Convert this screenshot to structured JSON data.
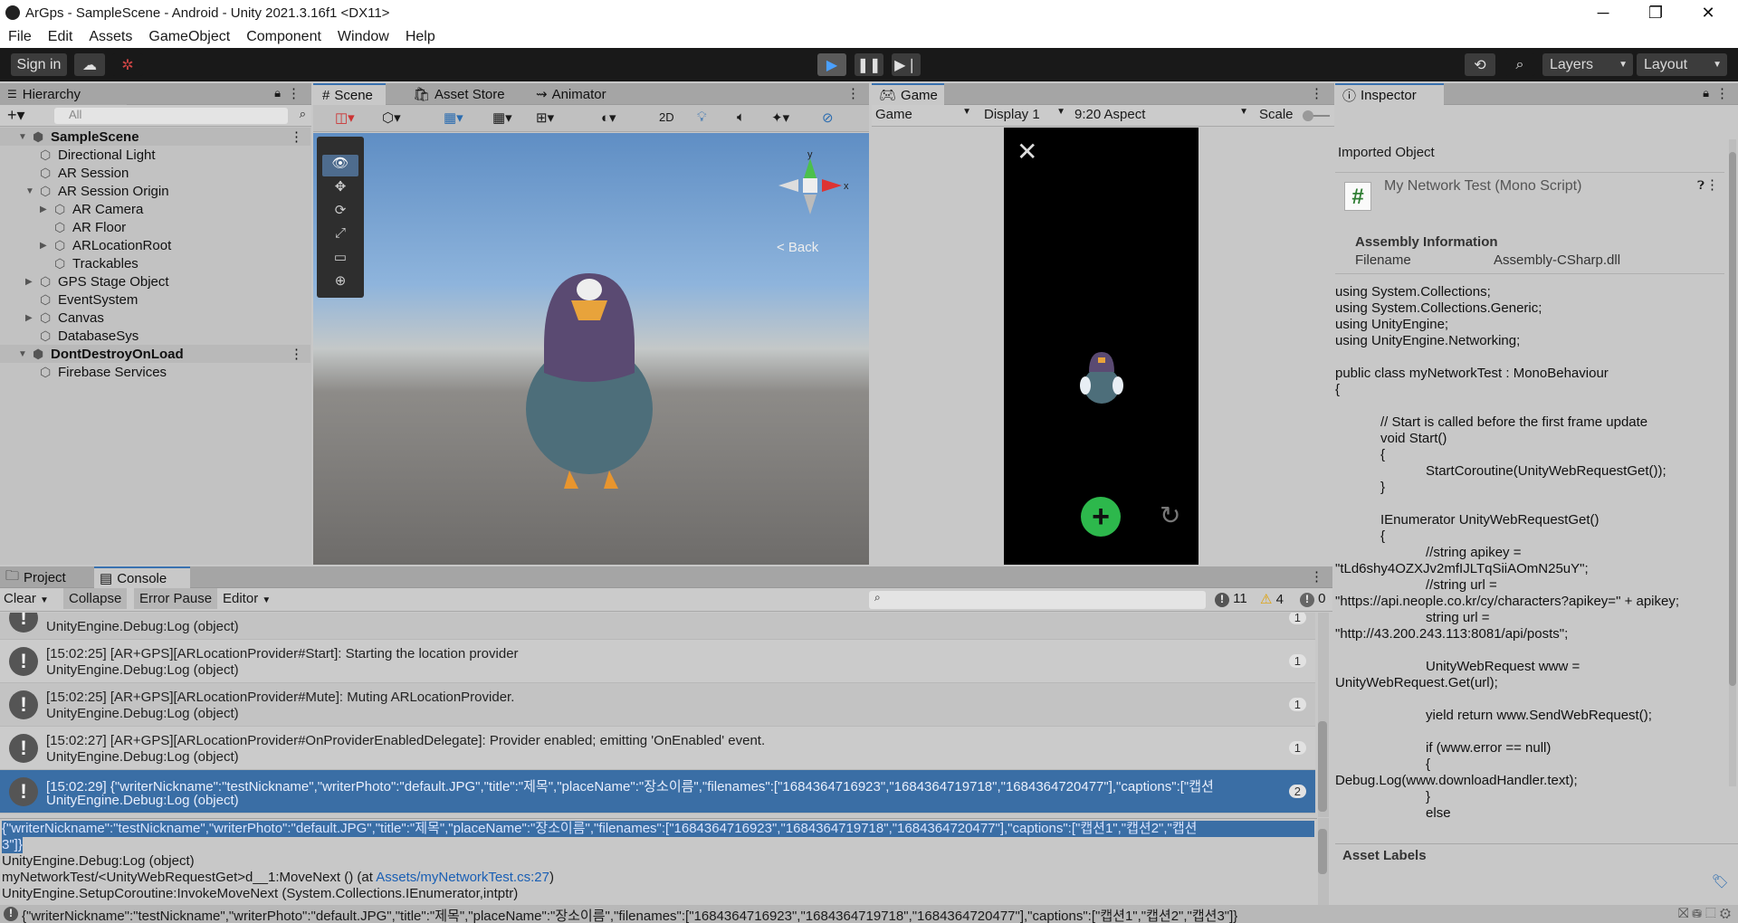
{
  "window": {
    "title": "ArGps - SampleScene - Android - Unity 2021.3.16f1 <DX11>"
  },
  "menu": [
    "File",
    "Edit",
    "Assets",
    "GameObject",
    "Component",
    "Window",
    "Help"
  ],
  "toolbar": {
    "sign_in": "Sign in",
    "layers": "Layers",
    "layout": "Layout"
  },
  "hierarchy": {
    "tab": "Hierarchy",
    "search_placeholder": "All",
    "items": [
      {
        "label": "SampleScene",
        "indent": 0,
        "scene": true,
        "expanded": true
      },
      {
        "label": "Directional Light",
        "indent": 2
      },
      {
        "label": "AR Session",
        "indent": 2
      },
      {
        "label": "AR Session Origin",
        "indent": 2,
        "expanded": true
      },
      {
        "label": "AR Camera",
        "indent": 3,
        "collapsed": true
      },
      {
        "label": "AR Floor",
        "indent": 3
      },
      {
        "label": "ARLocationRoot",
        "indent": 3,
        "collapsed": true
      },
      {
        "label": "Trackables",
        "indent": 3
      },
      {
        "label": "GPS Stage Object",
        "indent": 2,
        "collapsed": true
      },
      {
        "label": "EventSystem",
        "indent": 2
      },
      {
        "label": "Canvas",
        "indent": 2,
        "collapsed": true
      },
      {
        "label": "DatabaseSys",
        "indent": 2
      },
      {
        "label": "DontDestroyOnLoad",
        "indent": 0,
        "scene": true,
        "expanded": true
      },
      {
        "label": "Firebase Services",
        "indent": 2
      }
    ]
  },
  "scene": {
    "tabs": [
      "Scene",
      "Asset Store",
      "Animator"
    ],
    "mode_2d": "2D",
    "gizmo_back": "< Back",
    "axis_x": "x",
    "axis_y": "y"
  },
  "game": {
    "tab": "Game",
    "view": "Game",
    "display": "Display 1",
    "aspect": "9:20 Aspect",
    "scale": "Scale"
  },
  "inspector": {
    "tab": "Inspector",
    "imported": "Imported Object",
    "script_name": "My Network Test (Mono Script)",
    "assembly_header": "Assembly Information",
    "filename_label": "Filename",
    "filename_value": "Assembly-CSharp.dll",
    "asset_labels": "Asset Labels",
    "code": [
      "using System.Collections;",
      "using System.Collections.Generic;",
      "using UnityEngine;",
      "using UnityEngine.Networking;",
      "",
      "public class myNetworkTest : MonoBehaviour",
      "{",
      "",
      "            // Start is called before the first frame update",
      "            void Start()",
      "            {",
      "                        StartCoroutine(UnityWebRequestGet());",
      "            }",
      "",
      "            IEnumerator UnityWebRequestGet()",
      "            {",
      "                        //string apikey =",
      "\"tLd6shy4OZXJv2mfIJLTqSiiAOmN25uY\";",
      "                        //string url =",
      "\"https://api.neople.co.kr/cy/characters?apikey=\" + apikey;",
      "                        string url =",
      "\"http://43.200.243.113:8081/api/posts\";",
      "",
      "                        UnityWebRequest www =",
      "UnityWebRequest.Get(url);",
      "",
      "                        yield return www.SendWebRequest();",
      "",
      "                        if (www.error == null)",
      "                        {",
      "Debug.Log(www.downloadHandler.text);",
      "                        }",
      "                        else"
    ]
  },
  "console": {
    "tabs": [
      "Project",
      "Console"
    ],
    "clear": "Clear",
    "collapse": "Collapse",
    "error_pause": "Error Pause",
    "editor": "Editor",
    "count_log": "11",
    "count_warn": "4",
    "count_err": "0",
    "entries": [
      {
        "l1": "",
        "l2": "UnityEngine.Debug:Log (object)",
        "count": "1"
      },
      {
        "l1": "[15:02:25] [AR+GPS][ARLocationProvider#Start]: Starting the location provider",
        "l2": "UnityEngine.Debug:Log (object)",
        "count": "1"
      },
      {
        "l1": "[15:02:25] [AR+GPS][ARLocationProvider#Mute]: Muting ARLocationProvider.",
        "l2": "UnityEngine.Debug:Log (object)",
        "count": "1"
      },
      {
        "l1": "[15:02:27] [AR+GPS][ARLocationProvider#OnProviderEnabledDelegate]: Provider enabled; emitting 'OnEnabled' event.",
        "l2": "UnityEngine.Debug:Log (object)",
        "count": "1"
      },
      {
        "l1": "[15:02:29] {\"writerNickname\":\"testNickname\",\"writerPhoto\":\"default.JPG\",\"title\":\"제목\",\"placeName\":\"장소이름\",\"filenames\":[\"1684364716923\",\"1684364719718\",\"1684364720477\"],\"captions\":[\"캡션",
        "l2": "UnityEngine.Debug:Log (object)",
        "count": "2",
        "selected": true
      }
    ],
    "detail_sel1": "{\"writerNickname\":\"testNickname\",\"writerPhoto\":\"default.JPG\",\"title\":\"제목\",\"placeName\":\"장소이름\",\"filenames\":[\"1684364716923\",\"1684364719718\",\"1684364720477\"],\"captions\":[\"캡션1\",\"캡션2\",\"캡션",
    "detail_sel2": "3\"]}",
    "detail_l3": "UnityEngine.Debug:Log (object)",
    "detail_l4a": "myNetworkTest/<UnityWebRequestGet>d__1:MoveNext () (at ",
    "detail_link": "Assets/myNetworkTest.cs:27",
    "detail_l4b": ")",
    "detail_l5": "UnityEngine.SetupCoroutine:InvokeMoveNext (System.Collections.IEnumerator,intptr)"
  },
  "status": {
    "text": "{\"writerNickname\":\"testNickname\",\"writerPhoto\":\"default.JPG\",\"title\":\"제목\",\"placeName\":\"장소이름\",\"filenames\":[\"1684364716923\",\"1684364719718\",\"1684364720477\"],\"captions\":[\"캡션1\",\"캡션2\",\"캡션3\"]}"
  }
}
